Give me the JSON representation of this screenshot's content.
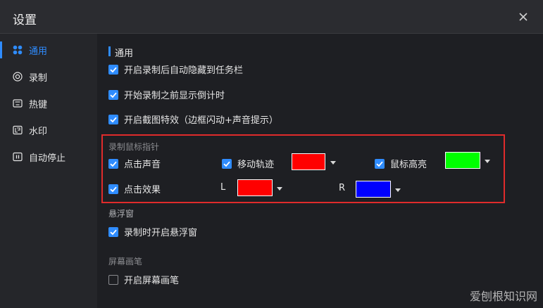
{
  "window": {
    "title": "设置"
  },
  "sidebar": {
    "items": [
      {
        "label": "通用",
        "icon": "grid-icon",
        "active": true
      },
      {
        "label": "录制",
        "icon": "record-icon",
        "active": false
      },
      {
        "label": "热键",
        "icon": "keyboard-icon",
        "active": false
      },
      {
        "label": "水印",
        "icon": "watermark-icon",
        "active": false
      },
      {
        "label": "自动停止",
        "icon": "auto-stop-icon",
        "active": false
      }
    ]
  },
  "general": {
    "title": "通用",
    "options": [
      {
        "label": "开启录制后自动隐藏到任务栏",
        "checked": true
      },
      {
        "label": "开始录制之前显示倒计时",
        "checked": true
      },
      {
        "label": "开启截图特效（边框闪动+声音提示）",
        "checked": true
      }
    ]
  },
  "mouse_pointer": {
    "title": "录制鼠标指针",
    "click_sound": {
      "label": "点击声音",
      "checked": true
    },
    "move_track": {
      "label": "移动轨迹",
      "checked": true,
      "color": "#ff0000"
    },
    "mouse_highlight": {
      "label": "鼠标高亮",
      "checked": true,
      "color": "#00ff00"
    },
    "click_effect": {
      "label": "点击效果",
      "checked": true
    },
    "left": {
      "label": "L",
      "color": "#ff0000"
    },
    "right": {
      "label": "R",
      "color": "#0000ff"
    }
  },
  "float_window": {
    "title": "悬浮窗",
    "option": {
      "label": "录制时开启悬浮窗",
      "checked": true
    }
  },
  "screen_pen": {
    "title": "屏幕画笔",
    "option": {
      "label": "开启屏幕画笔",
      "checked": false
    }
  },
  "watermark_text": "爱刨根知识网",
  "colors": {
    "accent": "#2f8cff",
    "highlight_border": "#e02b2b"
  }
}
